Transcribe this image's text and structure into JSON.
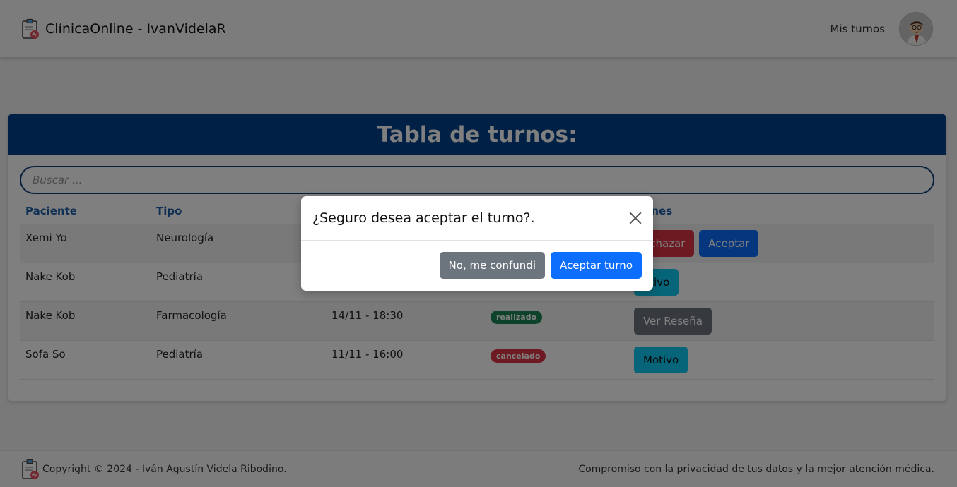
{
  "navbar": {
    "brand": "ClínicaOnline - IvanVidelaR",
    "logo_icon": "clipboard-medical-icon",
    "link": "Mis turnos",
    "avatar_icon": "doctor-avatar-icon"
  },
  "card": {
    "title": "Tabla de turnos:",
    "search_placeholder": "Buscar ...",
    "columns": [
      "Paciente",
      "Tipo",
      "",
      "",
      "ciones"
    ],
    "rows": [
      {
        "paciente": "Xemi Yo",
        "tipo": "Neurología",
        "fecha": "",
        "estado": "",
        "acciones": [
          "echazar",
          "Aceptar"
        ]
      },
      {
        "paciente": "Nake Kob",
        "tipo": "Pediatría",
        "fecha": "",
        "estado": "",
        "acciones": [
          "otivo"
        ]
      },
      {
        "paciente": "Nake Kob",
        "tipo": "Farmacología",
        "fecha": "14/11 - 18:30",
        "estado": "realizado",
        "acciones": [
          "Ver Reseña"
        ]
      },
      {
        "paciente": "Sofa So",
        "tipo": "Pediatría",
        "fecha": "11/11 - 16:00",
        "estado": "cancelado",
        "acciones": [
          "Motivo"
        ]
      }
    ]
  },
  "colors": {
    "header_blue": "#00418a",
    "danger": "#dc3545",
    "primary": "#0d6efd",
    "info": "#0dcaf0",
    "secondary": "#6c757d",
    "success": "#198754"
  },
  "modal": {
    "title": "¿Seguro desea aceptar el turno?.",
    "cancel_label": "No, me confundi",
    "confirm_label": "Aceptar turno"
  },
  "footer": {
    "copyright": "Copyright © 2024 - Iván Agustín Videla Ribodino.",
    "tagline": "Compromiso con la privacidad de tus datos y la mejor atención médica."
  }
}
